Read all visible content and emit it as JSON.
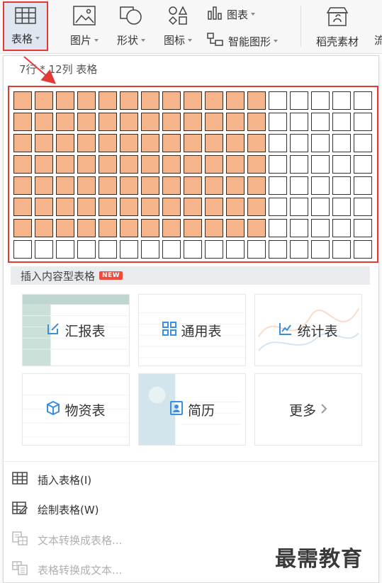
{
  "ribbon": {
    "table_btn": "表格",
    "picture_btn": "图片",
    "shape_btn": "形状",
    "icon_btn": "图标",
    "chart_btn": "图表",
    "smartart_btn": "智能图形",
    "daoke_btn": "稻壳素材",
    "extra_glyph": "流"
  },
  "dropdown": {
    "grid_info": "7行 * 12列 表格",
    "grid": {
      "rows": 8,
      "cols": 17,
      "selected_rows": 7,
      "selected_cols": 12
    },
    "section_title": "插入内容型表格",
    "new_badge": "NEW",
    "cards": [
      {
        "label": "汇报表",
        "icon": "report-edit-icon"
      },
      {
        "label": "通用表",
        "icon": "grid-squares-icon"
      },
      {
        "label": "统计表",
        "icon": "line-chart-icon"
      },
      {
        "label": "物资表",
        "icon": "cube-icon"
      },
      {
        "label": "简历",
        "icon": "resume-icon"
      },
      {
        "label": "更多",
        "icon": "chevron-right-icon"
      }
    ],
    "menu": [
      {
        "label": "插入表格(I)",
        "icon": "insert-table-icon",
        "enabled": true
      },
      {
        "label": "绘制表格(W)",
        "icon": "draw-table-icon",
        "enabled": true
      },
      {
        "label": "文本转换成表格...",
        "icon": "text-to-table-icon",
        "enabled": false
      },
      {
        "label": "表格转换成文本...",
        "icon": "table-to-text-icon",
        "enabled": false
      }
    ]
  },
  "watermark": "最需教育",
  "colors": {
    "selected_cell": "#f6b48b",
    "highlight": "#e53935",
    "accent_blue": "#3b8fe0"
  }
}
